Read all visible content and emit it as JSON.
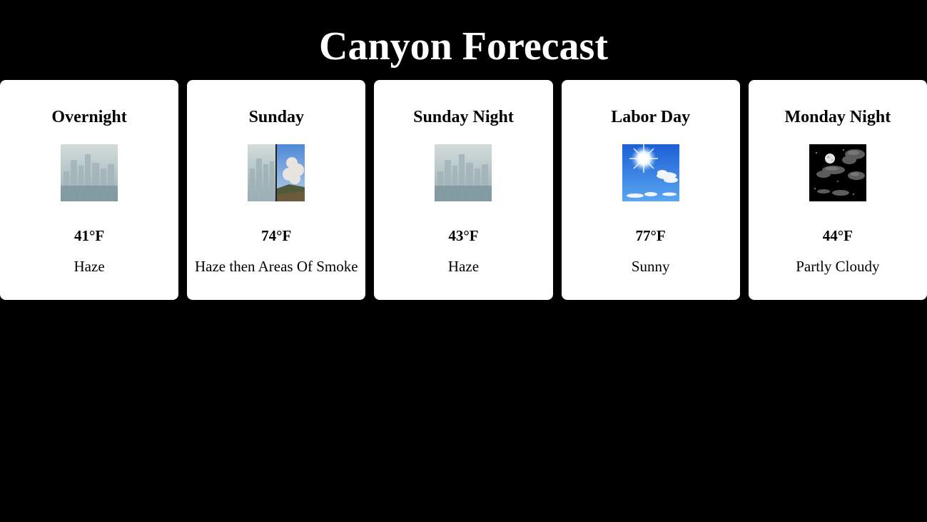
{
  "page": {
    "title": "Canyon Forecast"
  },
  "colors": {
    "background": "#000000",
    "card": "#ffffff",
    "text": "#000000",
    "title": "#ffffff"
  },
  "periods": [
    {
      "name": "Overnight",
      "icon": "haze-icon",
      "temperature": "41°F",
      "forecast": "Haze"
    },
    {
      "name": "Sunday",
      "icon": "haze-then-smoke-icon",
      "temperature": "74°F",
      "forecast": "Haze then Areas Of Smoke"
    },
    {
      "name": "Sunday Night",
      "icon": "haze-icon",
      "temperature": "43°F",
      "forecast": "Haze"
    },
    {
      "name": "Labor Day",
      "icon": "sunny-icon",
      "temperature": "77°F",
      "forecast": "Sunny"
    },
    {
      "name": "Monday Night",
      "icon": "partly-cloudy-night-icon",
      "temperature": "44°F",
      "forecast": "Partly Cloudy"
    }
  ]
}
